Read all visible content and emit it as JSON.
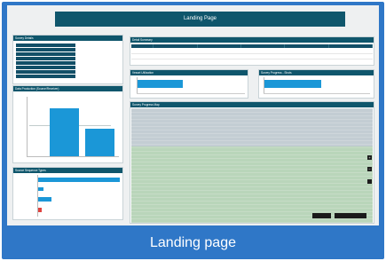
{
  "page": {
    "title": "Landing Page",
    "caption": "Landing page"
  },
  "panels": {
    "survey_details": "Survey Details",
    "detail_rows": [
      "",
      "",
      "",
      "",
      "",
      "",
      "",
      ""
    ],
    "detail_values": [
      "",
      ""
    ],
    "detail_summary": "Detail Summary",
    "summary_columns": [
      "",
      "",
      "",
      "",
      "",
      ""
    ],
    "summary_rows": [
      [
        "",
        "",
        "",
        "",
        "",
        ""
      ],
      [
        "",
        "",
        "",
        "",
        "",
        ""
      ]
    ],
    "vessel_utilization": "Vessel Utilization",
    "vessel_value": "",
    "survey_progress": "Survey Progress - Shots",
    "survey_value": "",
    "data_production": "Data Production (Source/Receiver)",
    "source_sequence": "Source Sequence Types",
    "survey_map": "Survey Progress Map",
    "map_note": "",
    "map_buttons": [
      "",
      ""
    ],
    "zoom_in": "+",
    "zoom_out": "−"
  },
  "charts": {
    "utilization_percent": 62,
    "survey_progress_percent": 60,
    "production_values": [
      0.78,
      0.45
    ],
    "sequence_values": [
      1.0,
      0.07,
      0.16,
      0.04
    ],
    "colors": {
      "bar": "#1b97d7",
      "header": "#0f566c",
      "accent_red": "#e0433f"
    }
  },
  "icons": [
    "zoom-in-icon",
    "zoom-out-icon",
    "fullscreen-icon"
  ]
}
